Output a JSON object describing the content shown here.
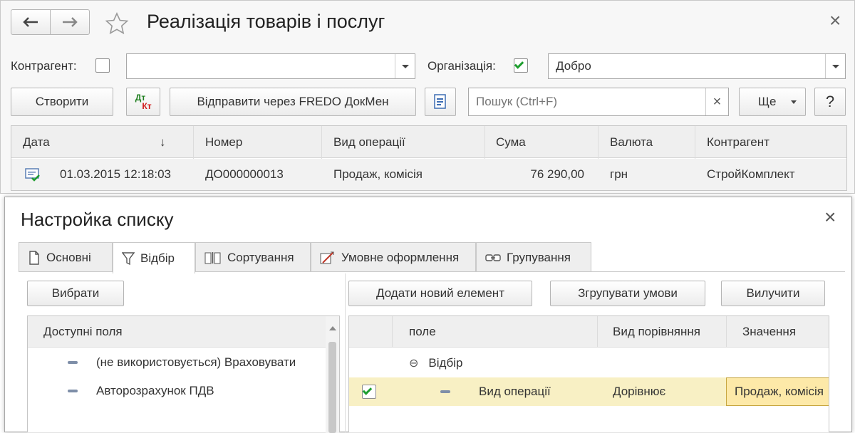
{
  "window": {
    "title": "Реалізація товарів і послуг",
    "back_icon": "arrow-left-icon",
    "forward_icon": "arrow-right-icon",
    "close": "×"
  },
  "filters": {
    "counterparty_label": "Контрагент:",
    "counterparty_checked": false,
    "counterparty_value": "",
    "organization_label": "Організація:",
    "organization_checked": true,
    "organization_value": "Добро"
  },
  "toolbar": {
    "create": "Створити",
    "dt_kt_top": "Дт",
    "dt_kt_bottom": "Кт",
    "send": "Відправити через FREDO ДокМен",
    "search_placeholder": "Пошук (Ctrl+F)",
    "search_clear": "×",
    "more": "Ще",
    "help": "?"
  },
  "list": {
    "columns": [
      "Дата",
      "Номер",
      "Вид операції",
      "Сума",
      "Валюта",
      "Контрагент"
    ],
    "sort_indicator": "↓",
    "rows": [
      {
        "date": "01.03.2015 12:18:03",
        "number": "ДО000000013",
        "operation": "Продаж, комісія",
        "sum": "76 290,00",
        "currency": "грн",
        "counterparty": "СтройКомплект"
      }
    ]
  },
  "dialog": {
    "title": "Настройка списку",
    "close": "×",
    "tabs": [
      {
        "label": "Основні",
        "icon": "document-icon"
      },
      {
        "label": "Відбір",
        "icon": "filter-icon",
        "active": true
      },
      {
        "label": "Сортування",
        "icon": "sort-icon"
      },
      {
        "label": "Умовне оформлення",
        "icon": "brush-icon"
      },
      {
        "label": "Групування",
        "icon": "group-icon"
      }
    ],
    "select_button": "Вибрати",
    "add_button": "Додати новий елемент",
    "group_button": "Згрупувати умови",
    "remove_button": "Вилучити",
    "available_header": "Доступні поля",
    "available_fields": [
      "(не використовується) Враховувати",
      "Авторозрахунок ПДВ"
    ],
    "filter_columns": [
      "поле",
      "Вид порівняння",
      "Значення"
    ],
    "filter_group": "Відбір",
    "filter_group_toggle": "⊖",
    "filter_row": {
      "checked": true,
      "field": "Вид операції",
      "comparison": "Дорівнює",
      "value": "Продаж, комісія"
    }
  },
  "colors": {
    "accent_green": "#1e9e2e",
    "highlight_row": "#f8f0c4",
    "value_cell": "#fde9a8"
  }
}
